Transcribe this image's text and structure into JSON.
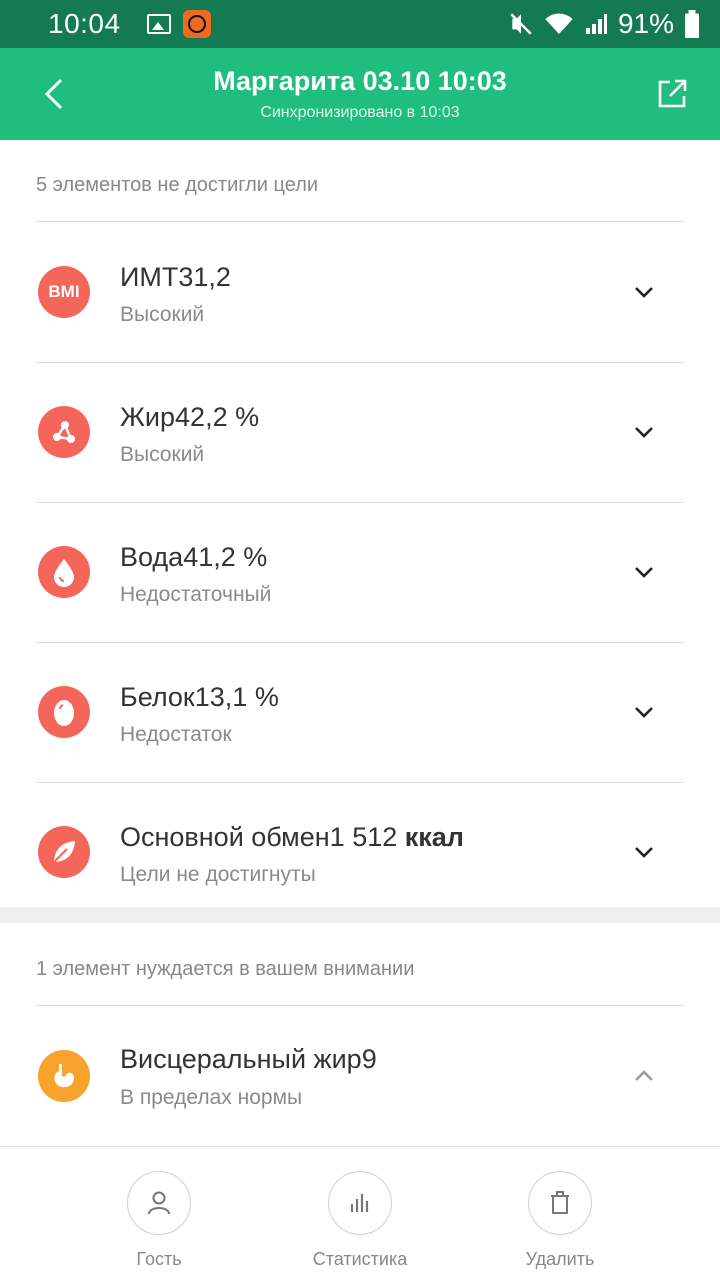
{
  "status_bar": {
    "time": "10:04",
    "battery": "91%",
    "icons": [
      "image-icon",
      "app-notification-icon",
      "mute-icon",
      "wifi-icon",
      "signal-icon",
      "battery-icon"
    ]
  },
  "header": {
    "title": "Маргарита 03.10 10:03",
    "subtitle": "Синхронизировано в 10:03",
    "background_color": "#1fbd7e",
    "status_bar_color": "#137a52"
  },
  "section_goals": {
    "title": "5 элементов не достигли цели",
    "items": [
      {
        "icon": "bmi-icon",
        "icon_text": "BMI",
        "label": "ИМТ",
        "value": "31,2",
        "unit": "",
        "status": "Высокий",
        "color": "#f4655a"
      },
      {
        "icon": "fat-icon",
        "label": "Жир",
        "value": "42,2",
        "unit": "%",
        "status": "Высокий",
        "color": "#f4655a"
      },
      {
        "icon": "water-drop-icon",
        "label": "Вода",
        "value": "41,2",
        "unit": "%",
        "status": "Недостаточный",
        "color": "#f4655a"
      },
      {
        "icon": "protein-egg-icon",
        "label": "Белок",
        "value": "13,1",
        "unit": "%",
        "status": "Недостаток",
        "color": "#f4655a"
      },
      {
        "icon": "leaf-icon",
        "label": "Основной обмен",
        "value": "1 512",
        "unit": "ккал",
        "status": "Цели не достигнуты",
        "color": "#f4655a"
      }
    ]
  },
  "section_attention": {
    "title": "1 элемент нуждается в вашем внимании",
    "items": [
      {
        "icon": "visceral-fat-icon",
        "label": "Висцеральный жир",
        "value": "9",
        "unit": "",
        "status": "В пределах нормы",
        "color": "#f8a12b"
      }
    ]
  },
  "bottom_bar": {
    "guest": "Гость",
    "stats": "Статистика",
    "delete": "Удалить"
  }
}
